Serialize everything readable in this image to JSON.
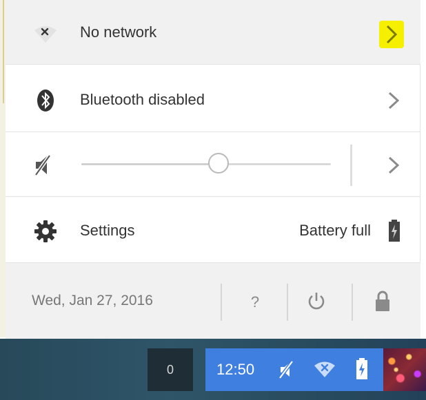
{
  "network": {
    "label": "No network",
    "icon": "wifi-off-icon"
  },
  "bluetooth": {
    "label": "Bluetooth disabled",
    "icon": "bluetooth-icon"
  },
  "volume": {
    "icon": "volume-muted-icon",
    "level_percent": 55
  },
  "settings": {
    "label": "Settings",
    "icon": "gear-icon"
  },
  "battery": {
    "label": "Battery full",
    "icon": "battery-charging-icon"
  },
  "footer": {
    "date": "Wed, Jan 27, 2016",
    "help_label": "?"
  },
  "taskbar": {
    "notification_count": "0",
    "time": "12:50"
  },
  "colors": {
    "tray": "#3f7fe0",
    "highlight": "#f5f000",
    "panel_bg": "#f1f1f1"
  }
}
